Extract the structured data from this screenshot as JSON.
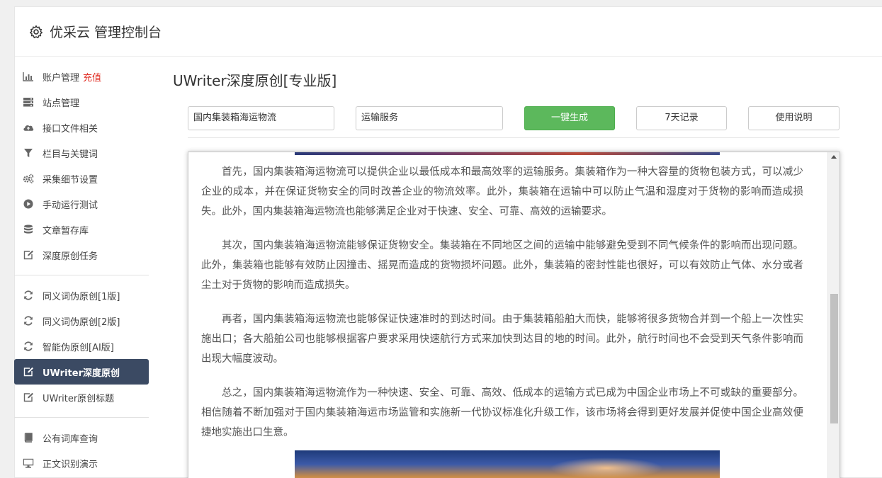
{
  "header": {
    "title": "优采云 管理控制台",
    "icon": "gear-icon"
  },
  "sidebar": {
    "group1": [
      {
        "label": "账户管理",
        "badge": "充值",
        "icon": "bar-chart-icon"
      },
      {
        "label": "站点管理",
        "icon": "server-icon"
      },
      {
        "label": "接口文件相关",
        "icon": "cloud-upload-icon"
      },
      {
        "label": "栏目与关键词",
        "icon": "filter-icon"
      },
      {
        "label": "采集细节设置",
        "icon": "gears-icon"
      },
      {
        "label": "手动运行测试",
        "icon": "play-circle-icon"
      },
      {
        "label": "文章暂存库",
        "icon": "database-icon"
      },
      {
        "label": "深度原创任务",
        "icon": "edit-icon"
      }
    ],
    "group2": [
      {
        "label": "同义词伪原创[1版]",
        "icon": "refresh-icon"
      },
      {
        "label": "同义词伪原创[2版]",
        "icon": "refresh-icon"
      },
      {
        "label": "智能伪原创[AI版]",
        "icon": "refresh-icon"
      },
      {
        "label": "UWriter深度原创",
        "icon": "edit-icon",
        "active": true
      },
      {
        "label": "UWriter原创标题",
        "icon": "edit-icon"
      }
    ],
    "group3": [
      {
        "label": "公有词库查询",
        "icon": "book-icon"
      },
      {
        "label": "正文识别演示",
        "icon": "desktop-icon"
      }
    ]
  },
  "main": {
    "title": "UWriter深度原创[专业版]",
    "keyword1": "国内集装箱海运物流",
    "keyword2": "运输服务",
    "generate_label": "一键生成",
    "history_label": "7天记录",
    "help_label": "使用说明"
  },
  "article": {
    "paragraphs": [
      "首先，国内集装箱海运物流可以提供企业以最低成本和最高效率的运输服务。集装箱作为一种大容量的货物包装方式，可以减少企业的成本，并在保证货物安全的同时改善企业的物流效率。此外，集装箱在运输中可以防止气温和湿度对于货物的影响而造成损失。此外，国内集装箱海运物流也能够满足企业对于快速、安全、可靠、高效的运输要求。",
      "其次，国内集装箱海运物流能够保证货物安全。集装箱在不同地区之间的运输中能够避免受到不同气候条件的影响而出现问题。此外，集装箱也能够有效防止因撞击、摇晃而造成的货物损坏问题。此外，集装箱的密封性能也很好，可以有效防止气体、水分或者尘土对于货物的影响而造成损失。",
      "再者，国内集装箱海运物流也能够保证快速准时的到达时间。由于集装箱船舶大而快，能够将很多货物合并到一个船上一次性实施出口；各大船舶公司也能够根据客户要求采用快速航行方式来加快到达目的地的时间。此外，航行时间也不会受到天气条件影响而出现大幅度波动。",
      "总之，国内集装箱海运物流作为一种快速、安全、可靠、高效、低成本的运输方式已成为中国企业市场上不可或缺的重要部分。相信随着不断加强对于国内集装箱海运市场监管和实施新一代协议标准化升级工作，该市场将会得到更好发展并促使中国企业高效便捷地实施出口生意。"
    ]
  },
  "colors": {
    "active_bg": "#3b4a63",
    "primary_btn": "#5cb85c",
    "badge": "#e0281e"
  }
}
